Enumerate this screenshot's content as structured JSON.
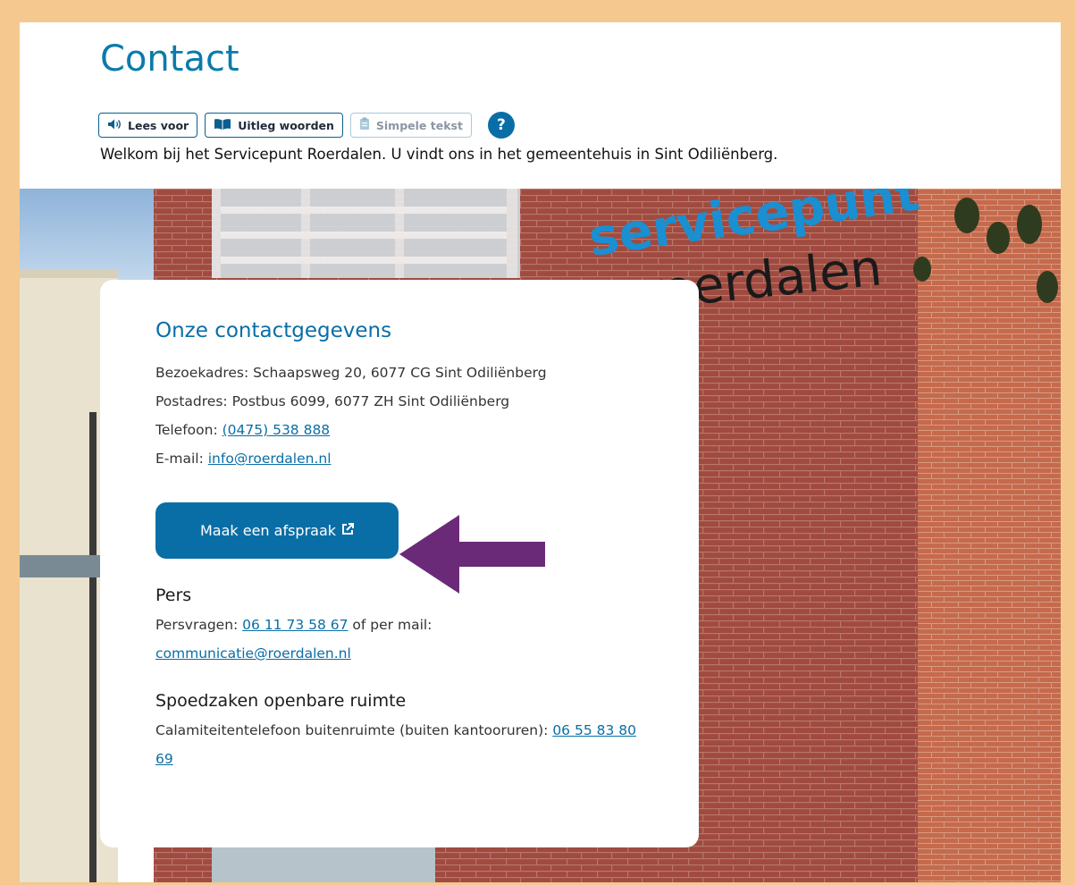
{
  "page": {
    "title": "Contact",
    "welcome": "Welkom bij het Servicepunt Roerdalen. U vindt ons in het gemeentehuis in Sint Odiliënberg."
  },
  "toolbar": {
    "read_aloud": "Lees voor",
    "explain_words": "Uitleg woorden",
    "simple_text": "Simpele tekst",
    "help": "?"
  },
  "hero": {
    "sign_line1": "servicepunt",
    "sign_line2": "roerdalen"
  },
  "contact": {
    "heading": "Onze contactgegevens",
    "visit_label": "Bezoekadres: ",
    "visit_value": "Schaapsweg 20, 6077 CG Sint Odiliënberg",
    "post_label": "Postadres: ",
    "post_value": "Postbus 6099, 6077 ZH Sint Odiliënberg",
    "phone_label": "Telefoon: ",
    "phone_value": "(0475) 538 888",
    "email_label": "E-mail: ",
    "email_value": "info@roerdalen.nl",
    "appointment_button": "Maak een afspraak"
  },
  "press": {
    "heading": "Pers",
    "label": "Persvragen: ",
    "phone": "06 11 73 58 67",
    "between": " of per mail: ",
    "email": "communicatie@roerdalen.nl"
  },
  "emergency": {
    "heading": "Spoedzaken openbare ruimte",
    "label": "Calamiteitentelefoon buitenruimte (buiten kantooruren): ",
    "phone": "06 55 83 80 69"
  },
  "colors": {
    "accent": "#0a6ea6",
    "annotation_arrow": "#6b2a78",
    "frame": "#f5c88f"
  }
}
